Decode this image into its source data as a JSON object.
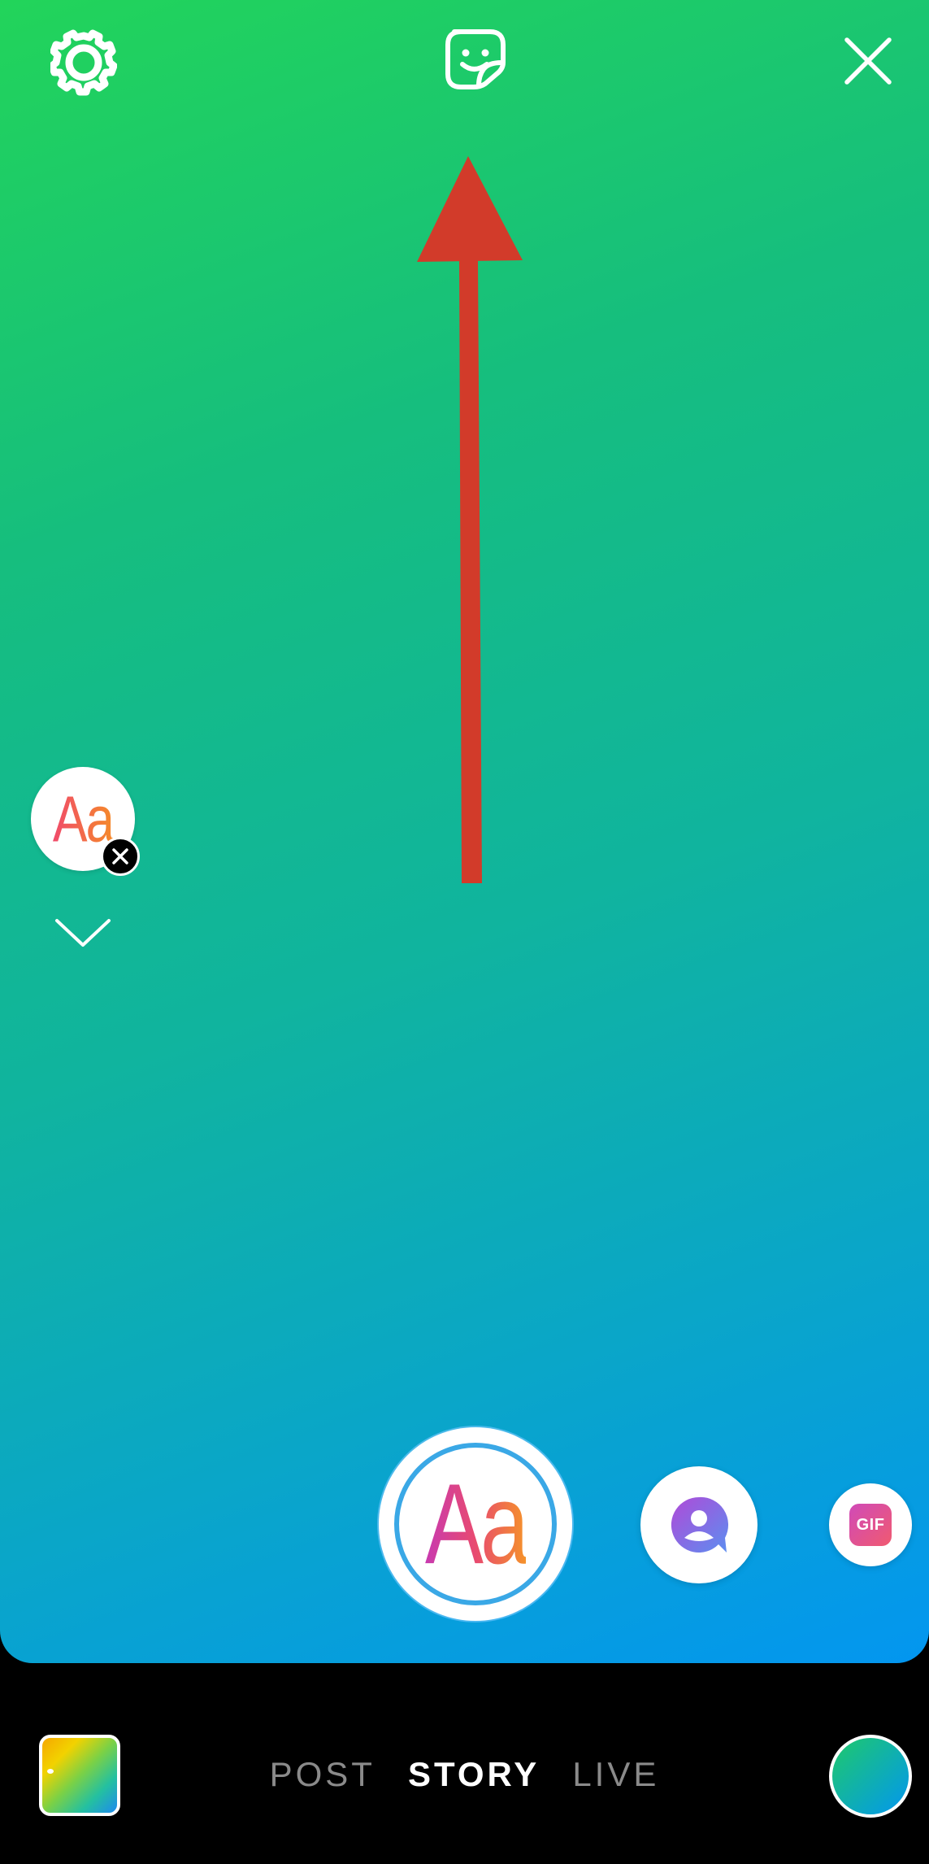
{
  "toolbar": {
    "settings_icon": "gear-icon",
    "sticker_icon": "sticker-smile-icon",
    "close_icon": "close-icon"
  },
  "annotation": {
    "arrow_color": "#d23b2a"
  },
  "tools": {
    "text_tool_label": "Aa",
    "remove_icon": "close-icon",
    "expand_icon": "chevron-down-icon"
  },
  "create_bar": {
    "create_label": "Aa",
    "mention_icon": "mention-icon",
    "gif_label": "GIF"
  },
  "modes": {
    "items": [
      "POST",
      "STORY",
      "LIVE"
    ],
    "active": "STORY"
  },
  "colors": {
    "gradient_start": "#22d45a",
    "gradient_end": "#0396f0",
    "ring_blue": "#3aa8e6"
  }
}
